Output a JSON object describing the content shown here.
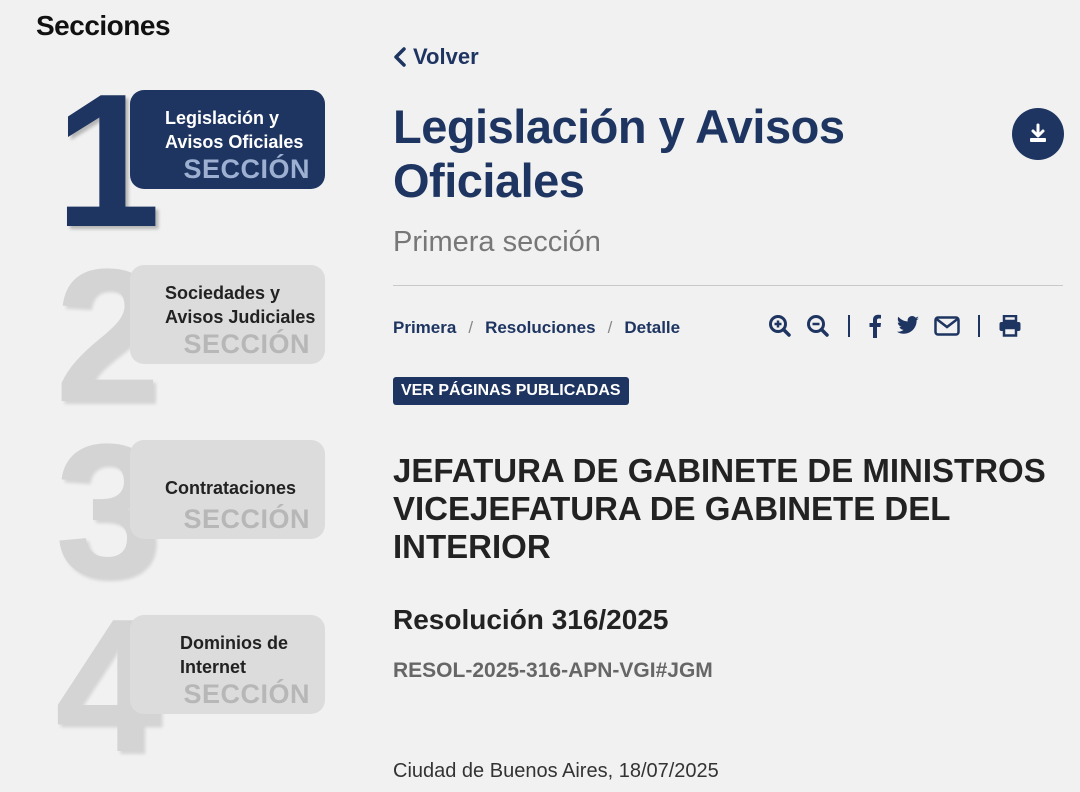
{
  "sidebar": {
    "title": "Secciones",
    "sections": [
      {
        "number": "1",
        "label_line1": "Legislación y",
        "label_line2": "Avisos Oficiales",
        "sub": "SECCIÓN"
      },
      {
        "number": "2",
        "label_line1": "Sociedades y",
        "label_line2": "Avisos Judiciales",
        "sub": "SECCIÓN"
      },
      {
        "number": "3",
        "label_line1": "Contrataciones",
        "label_line2": "",
        "sub": "SECCIÓN"
      },
      {
        "number": "4",
        "label_line1": "Dominios de",
        "label_line2": "Internet",
        "sub": "SECCIÓN"
      }
    ]
  },
  "main": {
    "back_label": "Volver",
    "title_line1": "Legislación y Avisos",
    "title_line2": "Oficiales",
    "subtitle": "Primera sección",
    "breadcrumb": [
      "Primera",
      "Resoluciones",
      "Detalle"
    ],
    "breadcrumb_sep": "/",
    "ver_paginas": "VER PÁGINAS PUBLICADAS",
    "entity_lines": [
      "JEFATURA DE GABINETE DE MINISTROS",
      "VICEJEFATURA DE GABINETE DEL",
      "INTERIOR"
    ],
    "resolution": "Resolución 316/2025",
    "code": "RESOL-2025-316-APN-VGI#JGM",
    "place_date": "Ciudad de Buenos Aires, 18/07/2025"
  },
  "tools": [
    "zoom-in-icon",
    "zoom-out-icon",
    "facebook-icon",
    "twitter-icon",
    "email-icon",
    "print-icon"
  ],
  "colors": {
    "brand": "#1e3561",
    "background": "#f1f1f1",
    "inactive_card": "#dcdcdc"
  }
}
